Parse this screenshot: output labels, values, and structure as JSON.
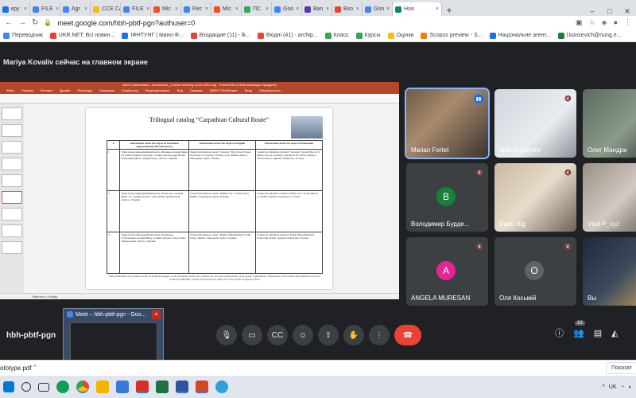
{
  "browser": {
    "tabs": [
      {
        "label": "кру",
        "color": "#1a73e8"
      },
      {
        "label": "FILE",
        "color": "#4285f4"
      },
      {
        "label": "Agr",
        "color": "#4285f4"
      },
      {
        "label": "CCE САП",
        "color": "#fbbc04"
      },
      {
        "label": "FILE",
        "color": "#4285f4"
      },
      {
        "label": "Mic",
        "color": "#f25022"
      },
      {
        "label": "Рис",
        "color": "#4285f4"
      },
      {
        "label": "Mic",
        "color": "#f25022"
      },
      {
        "label": "ПС",
        "color": "#34a853"
      },
      {
        "label": "Goo",
        "color": "#4285f4"
      },
      {
        "label": "Ban",
        "color": "#5e35b1"
      },
      {
        "label": "Bxo",
        "color": "#ea4335"
      },
      {
        "label": "Goo",
        "color": "#4285f4"
      },
      {
        "label": "Ноя",
        "color": "#00897b",
        "active": true
      }
    ],
    "url": "meet.google.com/hbh-pbtf-pgn?authuser=0",
    "bookmarks": [
      "Переводчик",
      "UKR.NET: Всі новин...",
      "ІФНТУНГ | Івано-Ф...",
      "Входящие (11) - lk...",
      "Вхідні (41) - archip...",
      "Класс",
      "Курсы",
      "Оцінки",
      "Scopus preview - S...",
      "Національне агент...",
      "l.konsevich@nung.e..."
    ]
  },
  "meet": {
    "presenter_label": "Mariya Kovaliv сейчас на главном экране",
    "meeting_code": "hbh-pbtf-pgn",
    "participant_count": "10",
    "participants": [
      {
        "name": "Marian Fertel",
        "avatar": "",
        "video": true,
        "speaking": true
      },
      {
        "name": "Mariya Kovaliv",
        "avatar": "",
        "video": true
      },
      {
        "name": "Олег Мандри",
        "avatar": "",
        "video": true
      },
      {
        "name": "Володимир Бурде...",
        "avatar": "В",
        "color": "#188038"
      },
      {
        "name": "Radu Big",
        "avatar": "",
        "video": true
      },
      {
        "name": "Vlad P_xyz",
        "avatar": "",
        "video": true
      },
      {
        "name": "ANGELA MURESAN",
        "avatar": "A",
        "color": "#e52592"
      },
      {
        "name": "Оля Косьмій",
        "avatar": "O",
        "color": "#5f6368"
      },
      {
        "name": "Вы",
        "avatar": "",
        "video": true
      }
    ]
  },
  "presentation": {
    "window_title": "AEGY presentation, Documents_ | former meeting 15.04.2021.eng - PowerPoint (Сбой активации продукта)",
    "ribbon": [
      "Файл",
      "Главная",
      "Вставка",
      "Дизайн",
      "Переходы",
      "Анимация",
      "Слайд-шоу",
      "Рецензирование",
      "Вид",
      "Справка",
      "ABBYY FineReader",
      "Вход",
      "Общий доступ"
    ],
    "slide_title": "Trilingual catalog “Carpathian Cultural Route”",
    "table_headers": [
      "#",
      "Information about the object in Ukrainian (approximately 820 characters)",
      "Information about the object in English",
      "Information about the object in Romanian"
    ],
    "table_rows": [
      [
        "1",
        "Туристично-інформаційний центр «Велике» вулиця Мира 8 в м Бин будинку культури, селище міської ради Вєлик, Рахівський район, Закарпатська область, Україна",
        "Tourist information center \"Vezanya\" Mye Street 8 (near the House of Culture), Vezanya town, Rakhiv district, Zakarpattia region, Ukraine",
        "Centrul de informare turistică \"Vezanya\" Strada Mye nr. 8 (lângă Casa de Cultură), orășelul de tip urban Vezanya, raionul Rahiv, regiunea Zakarpatia, Ucraina"
      ],
      [
        "2",
        "Туристично-інформаційний центр «Рахів-Ліс» вулиця Миру 12, селище міського типу Рахів, Закарпатська область, Україна",
        "Tourist information center \"Rakhiv-Lis\" 12 Myr Street, Rakhiv, Zakarpattia region, Ukraine",
        "Centrul de informare turistică \"Rahiv-Lis\" Strada Mir nr. 12, Rahiv, regiunea Zakarpatia, Ucraina"
      ],
      [
        "3",
        "Туристично-інформаційний центр «Рахівське Гуцульщина» вулиця Миру, селище міського типу Рахів, Закарпатська область, Україна",
        "Tourist information center \"Rakhiv Hutsulshchyna\" Myr Street, Rakhiv, Zakarpattia region, Ukraine",
        "Centrul de informare turistică \"Rahiv Hutsulshchyna\" Strada Mir, Rahiv, regiunea Zakarpatia, Ucraina"
      ]
    ],
    "footer": "This publication was produced with the financial support of the European Union. Its contents are the sole responsibility of the public organization \"Association of Economic Development of Ivano-Frankivsk (AEDIF)\" and do not necessarily reflect the views of the European Union.",
    "status": "Заметки к слайду"
  },
  "preview": {
    "title": "Meet – hbh-pbtf-pgn - Goo...",
    "close": "×"
  },
  "downloads": {
    "file": "ototype.pdf",
    "show_all": "Показат"
  },
  "taskbar": {
    "lang": "UK",
    "apps": [
      "start",
      "search",
      "task-view",
      "edge",
      "chrome",
      "explorer",
      "store",
      "pdf",
      "excel",
      "word",
      "powerpoint",
      "telegram"
    ]
  }
}
